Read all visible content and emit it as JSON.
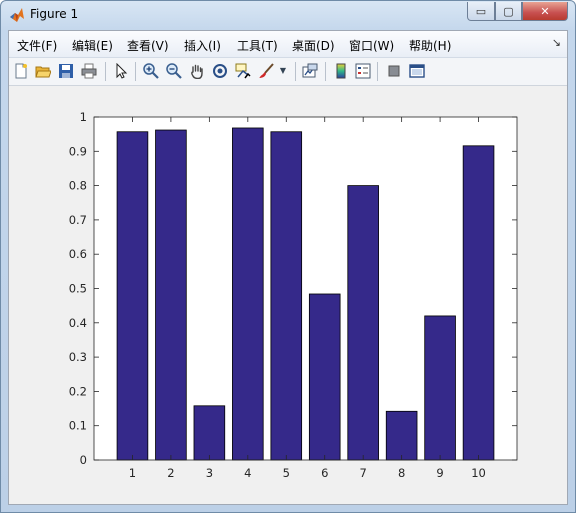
{
  "window": {
    "title": "Figure 1",
    "buttons": {
      "minimize": "▭",
      "maximize": "▢",
      "close": "✕"
    }
  },
  "menubar": {
    "items": [
      "文件(F)",
      "编辑(E)",
      "查看(V)",
      "插入(I)",
      "工具(T)",
      "桌面(D)",
      "窗口(W)",
      "帮助(H)"
    ],
    "overflow_icon": "corner-arrow-icon"
  },
  "toolbar": {
    "icons": [
      "new-figure-icon",
      "open-file-icon",
      "save-icon",
      "print-icon",
      "select-arrow-icon",
      "zoom-in-icon",
      "zoom-out-icon",
      "pan-hand-icon",
      "rotate-3d-icon",
      "data-cursor-icon",
      "brush-icon",
      "brush-dropdown-icon",
      "link-plot-icon",
      "colorbar-icon",
      "legend-icon",
      "hide-plot-tools-icon",
      "show-plot-tools-icon"
    ]
  },
  "colors": {
    "bar_fill": "#35298a",
    "axes_bg": "#ffffff",
    "figure_bg": "#f0f0f0"
  },
  "chart_data": {
    "type": "bar",
    "categories": [
      "1",
      "2",
      "3",
      "4",
      "5",
      "6",
      "7",
      "8",
      "9",
      "10"
    ],
    "values": [
      0.957,
      0.962,
      0.158,
      0.968,
      0.957,
      0.484,
      0.8,
      0.142,
      0.42,
      0.916
    ],
    "title": "",
    "xlabel": "",
    "ylabel": "",
    "ylim": [
      0,
      1
    ],
    "xlim": [
      0,
      11
    ],
    "yticks": [
      "0",
      "0.1",
      "0.2",
      "0.3",
      "0.4",
      "0.5",
      "0.6",
      "0.7",
      "0.8",
      "0.9",
      "1"
    ],
    "grid": false,
    "legend": "none"
  }
}
